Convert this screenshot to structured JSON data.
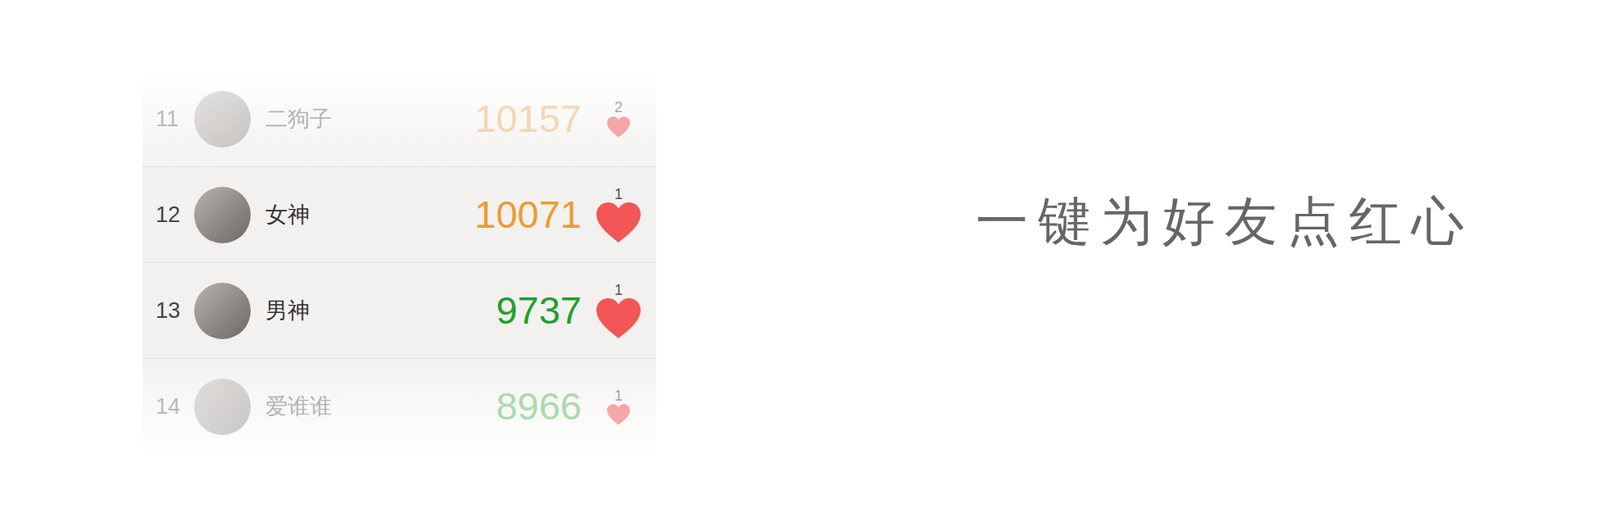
{
  "leaderboard": {
    "rows": [
      {
        "rank": "11",
        "name": "二狗子",
        "score": "10157",
        "likes": "2",
        "color": "#ee9a33",
        "dimmed": true
      },
      {
        "rank": "12",
        "name": "女神",
        "score": "10071",
        "likes": "1",
        "color": "#ee9a33",
        "dimmed": false
      },
      {
        "rank": "13",
        "name": "男神",
        "score": "9737",
        "likes": "1",
        "color": "#1fa12a",
        "dimmed": false
      },
      {
        "rank": "14",
        "name": "爱谁谁",
        "score": "8966",
        "likes": "1",
        "color": "#1fa12a",
        "dimmed": true
      }
    ]
  },
  "tagline": "一键为好友点红心"
}
